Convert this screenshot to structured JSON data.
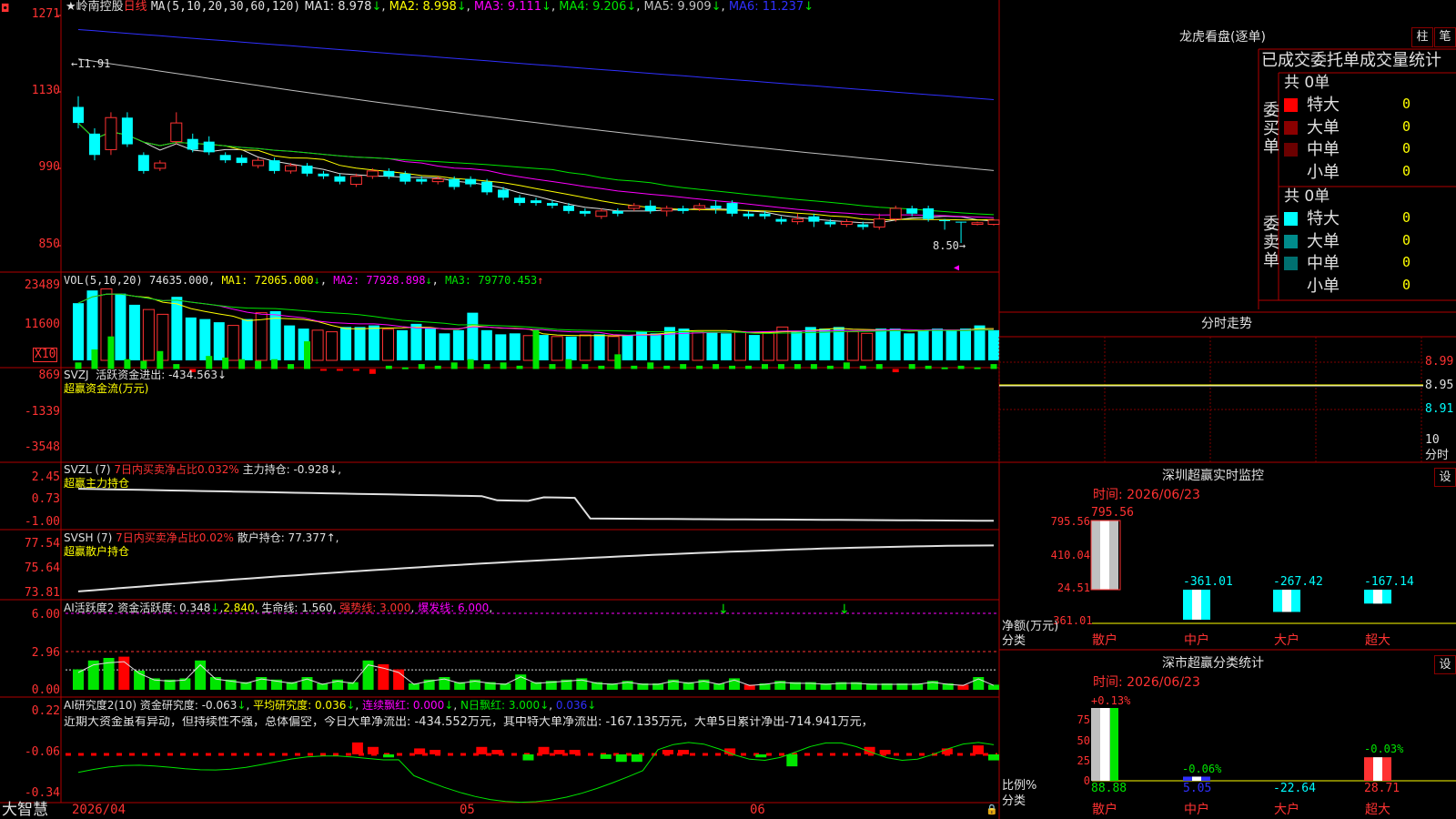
{
  "stock": {
    "name": "岭南控股",
    "period": "日线"
  },
  "brand": "大智慧",
  "main": {
    "ma_title": "MA(5,10,20,30,60,120)",
    "ma_items": [
      {
        "label": "MA1: 8.978",
        "arrow": "↓",
        "color": "#e0e0e0"
      },
      {
        "label": "MA2: 8.998",
        "arrow": "↓",
        "color": "#ffff00"
      },
      {
        "label": "MA3: 9.111",
        "arrow": "↓",
        "color": "#ff00ff"
      },
      {
        "label": "MA4: 9.206",
        "arrow": "↓",
        "color": "#00e600"
      },
      {
        "label": "MA5: 9.909",
        "arrow": "↓",
        "color": "#c0c0c0"
      },
      {
        "label": "MA6: 11.237",
        "arrow": "↓",
        "color": "#3030ff"
      }
    ],
    "y_labels": [
      "1271",
      "1130",
      "990",
      "850"
    ],
    "high_mark": "11.91",
    "low_mark": "8.50",
    "x_labels": [
      "2026/04",
      "05",
      "06"
    ]
  },
  "vol": {
    "title": "VOL(5,10,20)",
    "value": "74635.000",
    "items": [
      {
        "label": "MA1: 72065.000",
        "arrow": "↓",
        "color": "#ffff00"
      },
      {
        "label": "MA2: 77928.898",
        "arrow": "↓",
        "color": "#ff00ff"
      },
      {
        "label": "MA3: 79770.453",
        "arrow": "↑",
        "color": "#00e600"
      }
    ],
    "y_labels": [
      "23489",
      "11600"
    ],
    "unit": "X10"
  },
  "svzj": {
    "title": "SVZJ",
    "line": "活跃资金进出: -434.563",
    "arrow": "↓",
    "sub": "超赢资金流(万元)",
    "y_labels": [
      "869",
      "-1339",
      "-3548"
    ]
  },
  "svzl": {
    "title": "SVZL (7)",
    "ratio": "7日内买卖净占比0.032%",
    "hold": "主力持仓: -0.928",
    "arrow": "↓,",
    "sub": "超赢主力持仓",
    "y_labels": [
      "2.45",
      "0.73",
      "-1.00"
    ]
  },
  "svsh": {
    "title": "SVSH (7)",
    "ratio": "7日内买卖净占比0.02%",
    "hold": "散户持仓: 77.377",
    "arrow": "↑,",
    "sub": "超赢散户持仓",
    "y_labels": [
      "77.54",
      "75.64",
      "73.81"
    ]
  },
  "ai1": {
    "title": "AI活跃度2",
    "a": "资金活跃度: 0.348",
    "a_arrow": "↓",
    "b": "2.840",
    "c": "生命线: 1.560",
    "d": "强势线: 3.000",
    "e": "爆发线: 6.000",
    "y_labels": [
      "6.00",
      "2.96",
      "0.00"
    ]
  },
  "ai2": {
    "title": "AI研究度2(10)",
    "a": "资金研究度: -0.063",
    "b": "平均研究度: 0.036",
    "c": "连续飘红: 0.000",
    "d": "N日飘红: 3.000",
    "e": "0.036",
    "comment": "近期大资金虽有异动，但持续性不强，总体偏空，今日大单净流出: -434.552万元，其中特大单净流出: -167.135万元，大单5日累计净出-714.941万元，",
    "y_labels": [
      "0.22",
      "-0.06",
      "-0.34"
    ]
  },
  "longhu": {
    "title": "龙虎看盘(逐单)",
    "btn1": "柱",
    "btn2": "笔",
    "header": "已成交委托单成交量统计",
    "buy_label": "委买单",
    "sell_label": "委卖单",
    "buy_total": "共 0单",
    "sell_total": "共 0单",
    "buy_rows": [
      {
        "label": "特大",
        "value": "0",
        "color": "#ff0000"
      },
      {
        "label": "大单",
        "value": "0",
        "color": "#8b0000"
      },
      {
        "label": "中单",
        "value": "0",
        "color": "#6b0000"
      },
      {
        "label": "小单",
        "value": "0",
        "color": "#000000"
      }
    ],
    "sell_rows": [
      {
        "label": "特大",
        "value": "0",
        "color": "#00ffff"
      },
      {
        "label": "大单",
        "value": "0",
        "color": "#008b8b"
      },
      {
        "label": "中单",
        "value": "0",
        "color": "#007070"
      },
      {
        "label": "小单",
        "value": "0",
        "color": "#000000"
      }
    ]
  },
  "fenshi": {
    "title": "分时走势",
    "y_labels": [
      "8.99",
      "8.95",
      "8.91"
    ],
    "corner_top": "10",
    "corner_bottom": "分时"
  },
  "sz_monitor": {
    "title": "深圳超赢实时监控",
    "btn": "设",
    "time": "时间: 2026/06/23",
    "y_labels": [
      "795.56",
      "410.04",
      "24.51",
      "-361.01"
    ],
    "unit_label": "净额(万元)",
    "cat_label": "分类"
  },
  "sz_stat": {
    "title": "深市超赢分类统计",
    "btn": "设",
    "time": "时间: 2026/06/23",
    "y_labels": [
      "75",
      "50",
      "25",
      "0"
    ],
    "unit_label": "比例%",
    "cat_label": "分类"
  },
  "chart_data": [
    {
      "type": "candlestick",
      "title": "岭南控股 日线",
      "ylim": [
        8.5,
        11.91
      ],
      "y_ticks": [
        12.71,
        11.3,
        9.9,
        8.5
      ],
      "close_last": 8.978,
      "ma_last": {
        "MA1": 8.978,
        "MA2": 8.998,
        "MA3": 9.111,
        "MA4": 9.206,
        "MA5": 9.909,
        "MA6": 11.237
      },
      "candles": [
        {
          "o": 11.1,
          "c": 10.8,
          "h": 11.3,
          "l": 10.7
        },
        {
          "o": 10.6,
          "c": 10.2,
          "h": 10.7,
          "l": 10.1
        },
        {
          "o": 10.3,
          "c": 10.9,
          "h": 11.0,
          "l": 10.2
        },
        {
          "o": 10.9,
          "c": 10.4,
          "h": 11.0,
          "l": 10.35
        },
        {
          "o": 10.2,
          "c": 9.9,
          "h": 10.25,
          "l": 9.85
        },
        {
          "o": 9.95,
          "c": 10.05,
          "h": 10.1,
          "l": 9.9
        },
        {
          "o": 10.45,
          "c": 10.8,
          "h": 11.0,
          "l": 10.4
        },
        {
          "o": 10.5,
          "c": 10.3,
          "h": 10.6,
          "l": 10.25
        },
        {
          "o": 10.45,
          "c": 10.25,
          "h": 10.55,
          "l": 10.2
        },
        {
          "o": 10.2,
          "c": 10.1,
          "h": 10.25,
          "l": 10.05
        },
        {
          "o": 10.15,
          "c": 10.05,
          "h": 10.2,
          "l": 10.0
        },
        {
          "o": 10.0,
          "c": 10.1,
          "h": 10.15,
          "l": 9.95
        },
        {
          "o": 10.1,
          "c": 9.9,
          "h": 10.15,
          "l": 9.85
        },
        {
          "o": 9.9,
          "c": 10.0,
          "h": 10.05,
          "l": 9.85
        },
        {
          "o": 10.0,
          "c": 9.85,
          "h": 10.05,
          "l": 9.8
        },
        {
          "o": 9.85,
          "c": 9.8,
          "h": 9.9,
          "l": 9.75
        },
        {
          "o": 9.8,
          "c": 9.7,
          "h": 9.85,
          "l": 9.65
        },
        {
          "o": 9.65,
          "c": 9.8,
          "h": 9.85,
          "l": 9.6
        },
        {
          "o": 9.8,
          "c": 9.9,
          "h": 9.95,
          "l": 9.75
        },
        {
          "o": 9.9,
          "c": 9.8,
          "h": 9.95,
          "l": 9.75
        },
        {
          "o": 9.85,
          "c": 9.7,
          "h": 9.9,
          "l": 9.65
        },
        {
          "o": 9.75,
          "c": 9.7,
          "h": 9.8,
          "l": 9.65
        },
        {
          "o": 9.7,
          "c": 9.75,
          "h": 9.8,
          "l": 9.65
        },
        {
          "o": 9.75,
          "c": 9.6,
          "h": 9.8,
          "l": 9.55
        },
        {
          "o": 9.75,
          "c": 9.65,
          "h": 9.8,
          "l": 9.6
        },
        {
          "o": 9.7,
          "c": 9.5,
          "h": 9.75,
          "l": 9.45
        },
        {
          "o": 9.55,
          "c": 9.4,
          "h": 9.6,
          "l": 9.35
        },
        {
          "o": 9.4,
          "c": 9.3,
          "h": 9.45,
          "l": 9.25
        },
        {
          "o": 9.35,
          "c": 9.3,
          "h": 9.4,
          "l": 9.25
        },
        {
          "o": 9.3,
          "c": 9.25,
          "h": 9.35,
          "l": 9.2
        },
        {
          "o": 9.25,
          "c": 9.15,
          "h": 9.3,
          "l": 9.1
        },
        {
          "o": 9.15,
          "c": 9.1,
          "h": 9.2,
          "l": 9.05
        },
        {
          "o": 9.05,
          "c": 9.15,
          "h": 9.2,
          "l": 9.0
        },
        {
          "o": 9.15,
          "c": 9.1,
          "h": 9.2,
          "l": 9.05
        },
        {
          "o": 9.2,
          "c": 9.25,
          "h": 9.3,
          "l": 9.15
        },
        {
          "o": 9.25,
          "c": 9.15,
          "h": 9.35,
          "l": 9.1
        },
        {
          "o": 9.15,
          "c": 9.2,
          "h": 9.25,
          "l": 9.05
        },
        {
          "o": 9.2,
          "c": 9.15,
          "h": 9.25,
          "l": 9.1
        },
        {
          "o": 9.2,
          "c": 9.25,
          "h": 9.3,
          "l": 9.15
        },
        {
          "o": 9.25,
          "c": 9.2,
          "h": 9.35,
          "l": 9.1
        },
        {
          "o": 9.3,
          "c": 9.1,
          "h": 9.35,
          "l": 9.05
        },
        {
          "o": 9.1,
          "c": 9.05,
          "h": 9.15,
          "l": 9.0
        },
        {
          "o": 9.1,
          "c": 9.05,
          "h": 9.15,
          "l": 9.0
        },
        {
          "o": 9.0,
          "c": 8.95,
          "h": 9.05,
          "l": 8.9
        },
        {
          "o": 8.95,
          "c": 9.0,
          "h": 9.1,
          "l": 8.9
        },
        {
          "o": 9.05,
          "c": 8.95,
          "h": 9.1,
          "l": 8.85
        },
        {
          "o": 8.95,
          "c": 8.9,
          "h": 9.0,
          "l": 8.85
        },
        {
          "o": 8.9,
          "c": 8.95,
          "h": 9.0,
          "l": 8.85
        },
        {
          "o": 8.9,
          "c": 8.85,
          "h": 8.95,
          "l": 8.8
        },
        {
          "o": 8.85,
          "c": 9.0,
          "h": 9.1,
          "l": 8.8
        },
        {
          "o": 9.0,
          "c": 9.2,
          "h": 9.25,
          "l": 8.95
        },
        {
          "o": 9.2,
          "c": 9.1,
          "h": 9.25,
          "l": 9.05
        },
        {
          "o": 9.2,
          "c": 9.0,
          "h": 9.25,
          "l": 8.95
        },
        {
          "o": 8.98,
          "c": 8.96,
          "h": 9.0,
          "l": 8.8
        },
        {
          "o": 8.95,
          "c": 8.94,
          "h": 8.95,
          "l": 8.55
        },
        {
          "o": 8.9,
          "c": 8.93,
          "h": 8.95,
          "l": 8.88
        },
        {
          "o": 8.9,
          "c": 8.98,
          "h": 9.0,
          "l": 8.88
        }
      ]
    },
    {
      "type": "bar",
      "title": "VOL(5,10,20)",
      "unit": "X10",
      "ylim": [
        0,
        23489
      ],
      "values": [
        18000,
        22000,
        22500,
        21000,
        17500,
        16000,
        14500,
        20000,
        13500,
        13000,
        12000,
        11000,
        13000,
        15000,
        15500,
        11000,
        10000,
        9500,
        9000,
        10500,
        10500,
        11000,
        9800,
        9500,
        11500,
        10000,
        8500,
        9500,
        15000,
        9500,
        8200,
        8500,
        7800,
        8000,
        7500,
        7500,
        8000,
        8200,
        7500,
        8000,
        9000,
        8500,
        10500,
        10000,
        9000,
        9000,
        8500,
        9000,
        8000,
        9000,
        10500,
        9000,
        10500,
        10000,
        10500,
        9000,
        8500,
        10000,
        10000,
        8500,
        9500,
        10000,
        9500,
        10000,
        11000,
        9500
      ]
    },
    {
      "type": "bar",
      "title": "SVZJ 活跃资金进出",
      "ylim": [
        -3548,
        869
      ],
      "last": -434.563
    },
    {
      "type": "line",
      "title": "SVZL 主力持仓",
      "ylim": [
        -1.0,
        2.45
      ],
      "last": -0.928
    },
    {
      "type": "line",
      "title": "SVSH 散户持仓",
      "ylim": [
        73.81,
        77.54
      ],
      "last": 77.377
    },
    {
      "type": "bar",
      "title": "深圳超赢实时监控",
      "categories": [
        "散户",
        "中户",
        "大户",
        "超大"
      ],
      "values": [
        795.56,
        -361.01,
        -267.42,
        -167.14
      ],
      "value_labels": [
        "795.56",
        "-361.01",
        "-267.42",
        "-167.14"
      ],
      "ylim": [
        -361.01,
        795.56
      ]
    },
    {
      "type": "bar",
      "title": "深市超赢分类统计",
      "categories": [
        "散户",
        "中户",
        "大户",
        "超大"
      ],
      "values": [
        88.88,
        5.05,
        -22.64,
        28.71
      ],
      "value_labels": [
        "88.88",
        "5.05",
        "-22.64",
        "28.71"
      ],
      "change_labels": [
        "+0.13%",
        "-0.06%",
        "",
        "-0.03%"
      ],
      "ylim": [
        0,
        88.88
      ]
    }
  ]
}
